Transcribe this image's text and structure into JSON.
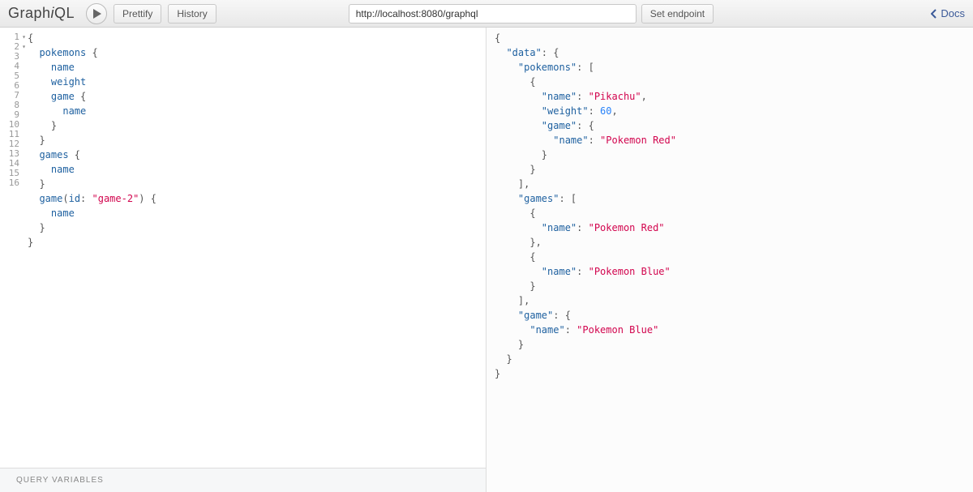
{
  "toolbar": {
    "title_plain_pre": "Graph",
    "title_italic": "i",
    "title_plain_post": "QL",
    "prettify": "Prettify",
    "history": "History",
    "endpoint_value": "http://localhost:8080/graphql",
    "set_endpoint": "Set endpoint",
    "docs": "Docs"
  },
  "editor": {
    "lines": {
      "l1": "{",
      "l2a": "  pokemons",
      "l2b": " {",
      "l3": "    name",
      "l4": "    weight",
      "l5a": "    game",
      "l5b": " {",
      "l6": "      name",
      "l7": "    }",
      "l8": "  }",
      "l9a": "  games",
      "l9b": " {",
      "l10": "    name",
      "l11": "  }",
      "l12a": "  game",
      "l12b": "(",
      "l12c": "id",
      "l12d": ": ",
      "l12e": "\"game-2\"",
      "l12f": ") {",
      "l13": "    name",
      "l14": "  }",
      "l15": "}"
    },
    "gutter": [
      "1",
      "2",
      "3",
      "4",
      "5",
      "6",
      "7",
      "8",
      "9",
      "10",
      "11",
      "12",
      "13",
      "14",
      "15",
      "16"
    ]
  },
  "vars_label": "QUERY VARIABLES",
  "result": {
    "l1": "{",
    "l2a": "  \"data\"",
    "l2b": ": {",
    "l3a": "    \"pokemons\"",
    "l3b": ": [",
    "l4": "      {",
    "l5a": "        \"name\"",
    "l5b": ": ",
    "l5c": "\"Pikachu\"",
    "l5d": ",",
    "l6a": "        \"weight\"",
    "l6b": ": ",
    "l6c": "60",
    "l6d": ",",
    "l7a": "        \"game\"",
    "l7b": ": {",
    "l8a": "          \"name\"",
    "l8b": ": ",
    "l8c": "\"Pokemon Red\"",
    "l9": "        }",
    "l10": "      }",
    "l11": "    ],",
    "l12a": "    \"games\"",
    "l12b": ": [",
    "l13": "      {",
    "l14a": "        \"name\"",
    "l14b": ": ",
    "l14c": "\"Pokemon Red\"",
    "l15": "      },",
    "l16": "      {",
    "l17a": "        \"name\"",
    "l17b": ": ",
    "l17c": "\"Pokemon Blue\"",
    "l18": "      }",
    "l19": "    ],",
    "l20a": "    \"game\"",
    "l20b": ": {",
    "l21a": "      \"name\"",
    "l21b": ": ",
    "l21c": "\"Pokemon Blue\"",
    "l22": "    }",
    "l23": "  }",
    "l24": "}"
  }
}
